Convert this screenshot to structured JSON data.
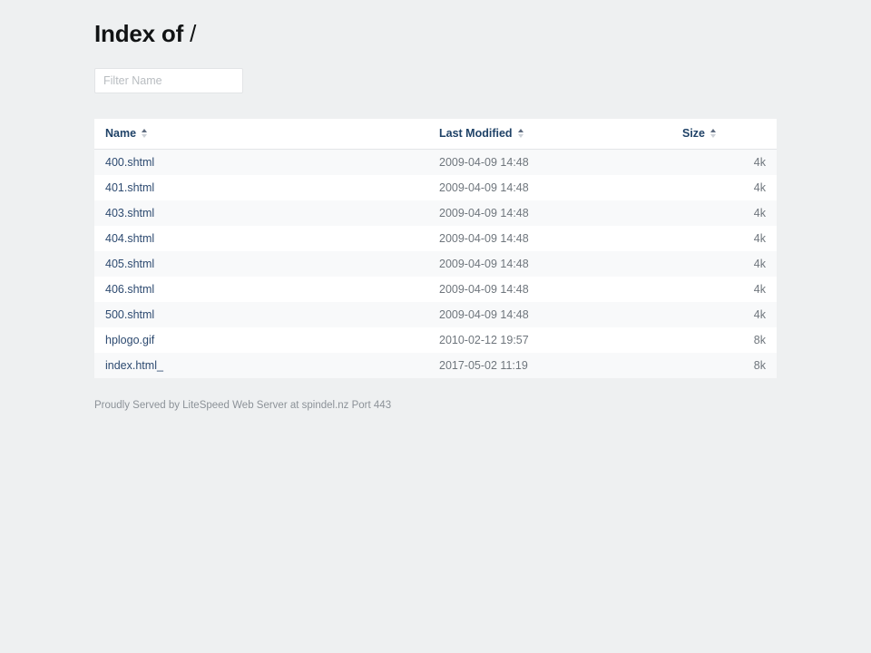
{
  "page": {
    "title_main": "Index of",
    "title_path": "/",
    "background_color": "#eef0f1"
  },
  "filter": {
    "placeholder": "Filter Name",
    "value": ""
  },
  "table": {
    "columns": [
      {
        "label": "Name",
        "sort_icon": "sort-arrows-icon",
        "align": "left"
      },
      {
        "label": "Last Modified",
        "sort_icon": "sort-arrows-icon",
        "align": "left"
      },
      {
        "label": "Size",
        "sort_icon": "sort-arrows-icon",
        "align": "right"
      }
    ],
    "rows": [
      {
        "name": "400.shtml",
        "modified": "2009-04-09 14:48",
        "size": "4k"
      },
      {
        "name": "401.shtml",
        "modified": "2009-04-09 14:48",
        "size": "4k"
      },
      {
        "name": "403.shtml",
        "modified": "2009-04-09 14:48",
        "size": "4k"
      },
      {
        "name": "404.shtml",
        "modified": "2009-04-09 14:48",
        "size": "4k"
      },
      {
        "name": "405.shtml",
        "modified": "2009-04-09 14:48",
        "size": "4k"
      },
      {
        "name": "406.shtml",
        "modified": "2009-04-09 14:48",
        "size": "4k"
      },
      {
        "name": "500.shtml",
        "modified": "2009-04-09 14:48",
        "size": "4k"
      },
      {
        "name": "hplogo.gif",
        "modified": "2010-02-12 19:57",
        "size": "8k"
      },
      {
        "name": "index.html_",
        "modified": "2017-05-02 11:19",
        "size": "8k"
      }
    ]
  },
  "footer": {
    "text": "Proudly Served by LiteSpeed Web Server at spindel.nz Port 443"
  },
  "colors": {
    "link": "#2d4a70",
    "header_text": "#1f4267",
    "body_text": "#6f767d",
    "stripe": "#f8f9fa"
  }
}
